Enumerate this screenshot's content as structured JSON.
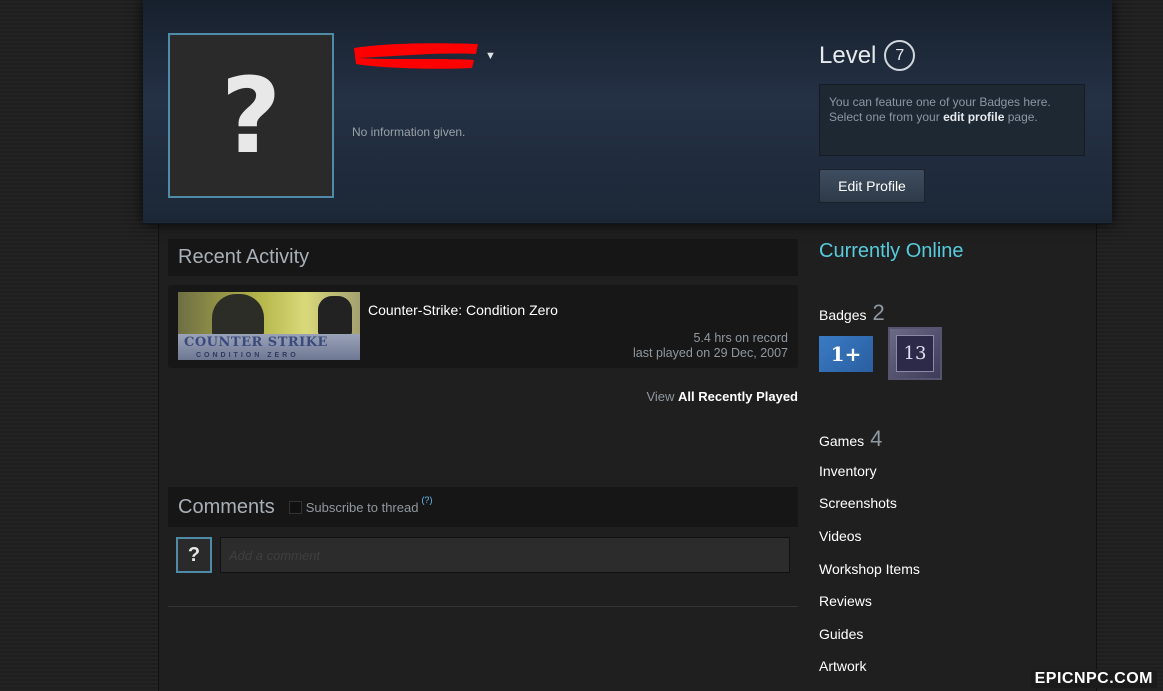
{
  "header": {
    "summary": "No information given.",
    "level_label": "Level",
    "level_value": "7",
    "badge_showcase": {
      "line1": "You can feature one of your Badges here.",
      "line2_prefix": "Select one from your ",
      "line2_link": "edit profile",
      "line2_suffix": " page."
    },
    "edit_profile": "Edit Profile"
  },
  "recent_activity": {
    "title": "Recent Activity",
    "game": {
      "name": "Counter-Strike: Condition Zero",
      "thumb_logo": "COUNTER STRIKE",
      "thumb_sub": "CONDITION ZERO",
      "hours": "5.4 hrs on record",
      "last_played": "last played on 29 Dec, 2007"
    },
    "view_prefix": "View ",
    "view_link": "All Recently Played"
  },
  "comments": {
    "title": "Comments",
    "subscribe": "Subscribe to thread",
    "help": "(?)",
    "placeholder": "Add a comment",
    "avatar_glyph": "?"
  },
  "sidebar": {
    "online": "Currently Online",
    "badges_label": "Badges",
    "badges_count": "2",
    "badge1_text": "1+",
    "badge2_text": "13",
    "games_label": "Games",
    "games_count": "4",
    "links": [
      "Inventory",
      "Screenshots",
      "Videos",
      "Workshop Items",
      "Reviews",
      "Guides",
      "Artwork"
    ]
  },
  "avatar_glyph": "?",
  "watermark": "EPICNPC.COM",
  "colors": {
    "accent_online": "#57cbde",
    "avatar_border": "#4f8aa6",
    "redaction": "#ff0000"
  }
}
